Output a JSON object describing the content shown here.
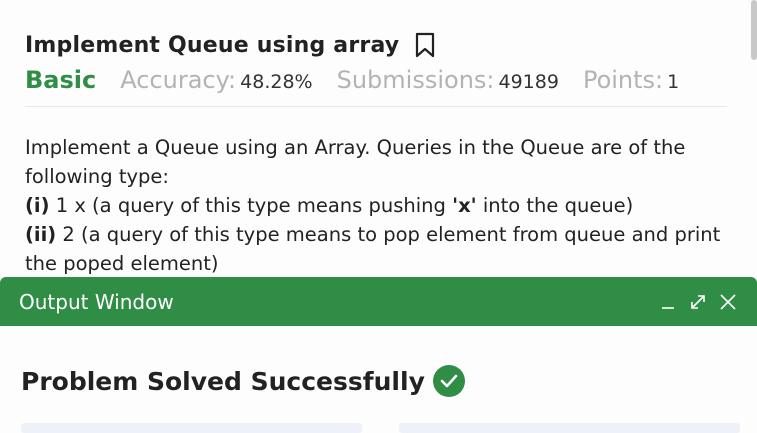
{
  "problem": {
    "title": "Implement Queue using array",
    "difficulty": "Basic",
    "accuracy_label": "Accuracy:",
    "accuracy_value": "48.28%",
    "submissions_label": "Submissions:",
    "submissions_value": "49189",
    "points_label": "Points:",
    "points_value": "1"
  },
  "description": {
    "line1": "Implement a Queue using an Array. Queries in the Queue are of the following type:",
    "q1_tag": "(i)",
    "q1_text": " 1 x   (a query of this type means  pushing ",
    "q1_bold": "'x'",
    "q1_tail": " into the queue)",
    "q2_tag": "(ii)",
    "q2_text": " 2    (a query of this type means to pop element from queue and print the poped element)"
  },
  "output_window": {
    "title": "Output Window",
    "status": "Problem Solved Successfully"
  },
  "colors": {
    "accent": "#2f8d46"
  },
  "icons": [
    "bookmark-icon",
    "minimize-icon",
    "expand-icon",
    "close-icon",
    "check-circle-icon"
  ]
}
